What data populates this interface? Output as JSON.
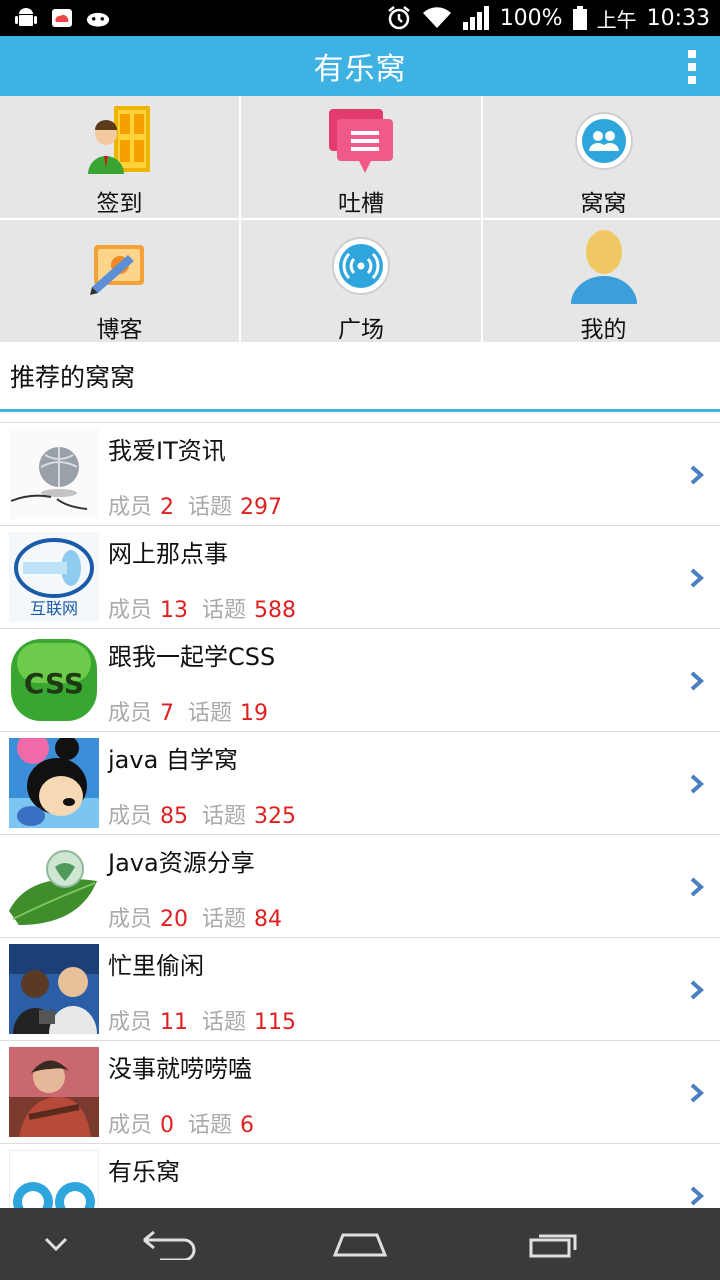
{
  "status_bar": {
    "battery": "100%",
    "ampm": "上午",
    "time": "10:33",
    "icons": [
      "android-icon",
      "cloud-app-icon",
      "android-game-icon",
      "alarm-icon",
      "wifi-icon",
      "signal-icon",
      "battery-icon"
    ]
  },
  "app": {
    "title": "有乐窝",
    "accent": "#3fb2e4"
  },
  "grid": [
    {
      "label": "签到",
      "icon": "door-person-icon"
    },
    {
      "label": "吐槽",
      "icon": "speech-bubble-icon"
    },
    {
      "label": "窝窝",
      "icon": "group-icon"
    },
    {
      "label": "博客",
      "icon": "notebook-pen-icon"
    },
    {
      "label": "广场",
      "icon": "broadcast-icon"
    },
    {
      "label": "我的",
      "icon": "user-icon"
    }
  ],
  "section": {
    "title": "推荐的窝窝"
  },
  "meta_labels": {
    "members": "成员",
    "topics": "话题"
  },
  "groups": [
    {
      "name": "我爱IT资讯",
      "members": "2",
      "topics": "297"
    },
    {
      "name": "网上那点事",
      "members": "13",
      "topics": "588",
      "thumb_text": "互联网"
    },
    {
      "name": "跟我一起学CSS",
      "members": "7",
      "topics": "19",
      "thumb_text": "CSS"
    },
    {
      "name": "java 自学窝",
      "members": "85",
      "topics": "325"
    },
    {
      "name": "Java资源分享",
      "members": "20",
      "topics": "84"
    },
    {
      "name": "忙里偷闲",
      "members": "11",
      "topics": "115"
    },
    {
      "name": "没事就唠唠嗑",
      "members": "0",
      "topics": "6"
    },
    {
      "name": "有乐窝"
    }
  ],
  "colors": {
    "count_red": "#e02020",
    "meta_gray": "#aaaaaa",
    "grid_bg": "#e6e6e6",
    "chevron": "#4a7fc0"
  }
}
